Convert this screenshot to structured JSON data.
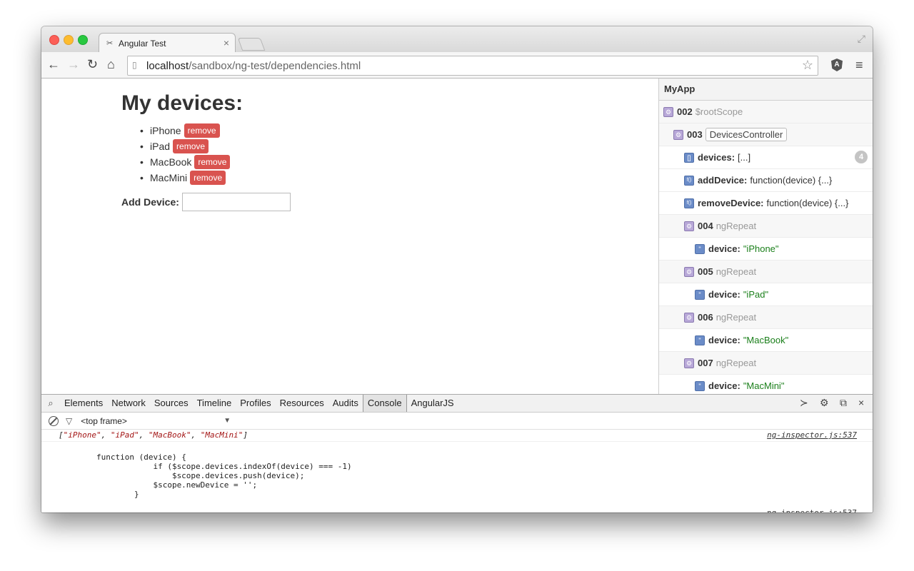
{
  "browser": {
    "tab_title": "Angular Test",
    "tab_close": "×",
    "url_host": "localhost",
    "url_path": "/sandbox/ng-test/dependencies.html"
  },
  "page": {
    "title": "My devices:",
    "devices": [
      {
        "name": "iPhone",
        "remove": "remove"
      },
      {
        "name": "iPad",
        "remove": "remove"
      },
      {
        "name": "MacBook",
        "remove": "remove"
      },
      {
        "name": "MacMini",
        "remove": "remove"
      }
    ],
    "add_label": "Add Device:",
    "add_value": ""
  },
  "ng_inspector": {
    "app_name": "MyApp",
    "root": {
      "id": "002",
      "name": "$rootScope"
    },
    "controller": {
      "id": "003",
      "name": "DevicesController"
    },
    "devices_key": "devices:",
    "devices_val": "[...]",
    "devices_count": "4",
    "add_key": "addDevice:",
    "add_val": "function(device) {...}",
    "remove_key": "removeDevice:",
    "remove_val": "function(device) {...}",
    "repeats": [
      {
        "id": "004",
        "name": "ngRepeat",
        "key": "device:",
        "value": "\"iPhone\""
      },
      {
        "id": "005",
        "name": "ngRepeat",
        "key": "device:",
        "value": "\"iPad\""
      },
      {
        "id": "006",
        "name": "ngRepeat",
        "key": "device:",
        "value": "\"MacBook\""
      },
      {
        "id": "007",
        "name": "ngRepeat",
        "key": "device:",
        "value": "\"MacMini\""
      }
    ]
  },
  "devtools": {
    "tabs": [
      "Elements",
      "Network",
      "Sources",
      "Timeline",
      "Profiles",
      "Resources",
      "Audits",
      "Console",
      "AngularJS"
    ],
    "active_tab": "Console",
    "frame": "<top frame>",
    "log1_open": "[",
    "log1_items": [
      "\"iPhone\"",
      "\"iPad\"",
      "\"MacBook\"",
      "\"MacMini\""
    ],
    "log1_sep": ", ",
    "log1_close": "]",
    "log_source": "ng-inspector.js:537",
    "log2_code": "function (device) {\n                    if ($scope.devices.indexOf(device) === -1)\n                        $scope.devices.push(device);\n                    $scope.newDevice = '';\n                }",
    "prompt": "›"
  }
}
